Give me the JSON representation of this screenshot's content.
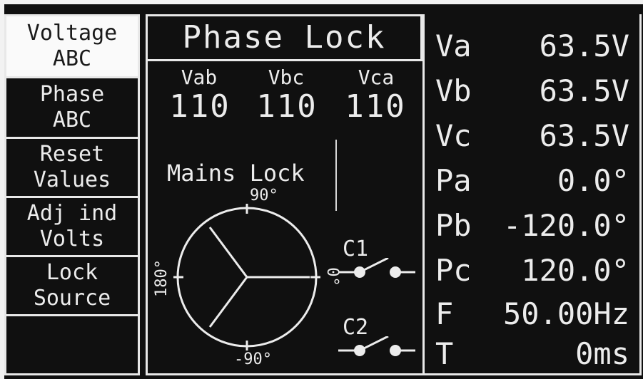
{
  "menu": {
    "items": [
      {
        "line1": "Voltage",
        "line2": "ABC",
        "active": true
      },
      {
        "line1": "Phase",
        "line2": "ABC",
        "active": false
      },
      {
        "line1": "Reset",
        "line2": "Values",
        "active": false
      },
      {
        "line1": "Adj ind",
        "line2": "Volts",
        "active": false
      },
      {
        "line1": "Lock",
        "line2": "Source",
        "active": false
      }
    ]
  },
  "center": {
    "title": "Phase Lock",
    "line_voltages": [
      {
        "label": "Vab",
        "value": "110"
      },
      {
        "label": "Vbc",
        "value": "110"
      },
      {
        "label": "Vca",
        "value": "110"
      }
    ],
    "mains_label": "Mains Lock",
    "phasor": {
      "top_label": "90°",
      "bottom_label": "-90°",
      "left_label": "180°",
      "right_label": "0°"
    },
    "contactors": [
      {
        "label": "C1",
        "state": "open"
      },
      {
        "label": "C2",
        "state": "open"
      }
    ]
  },
  "readouts": [
    {
      "name": "Va",
      "value": "63.5V"
    },
    {
      "name": "Vb",
      "value": "63.5V"
    },
    {
      "name": "Vc",
      "value": "63.5V"
    },
    {
      "name": "Pa",
      "value": "0.0°"
    },
    {
      "name": "Pb",
      "value": "-120.0°"
    },
    {
      "name": "Pc",
      "value": "120.0°"
    },
    {
      "name": "F",
      "value": "50.00Hz"
    },
    {
      "name": "T",
      "value": "0ms"
    }
  ]
}
